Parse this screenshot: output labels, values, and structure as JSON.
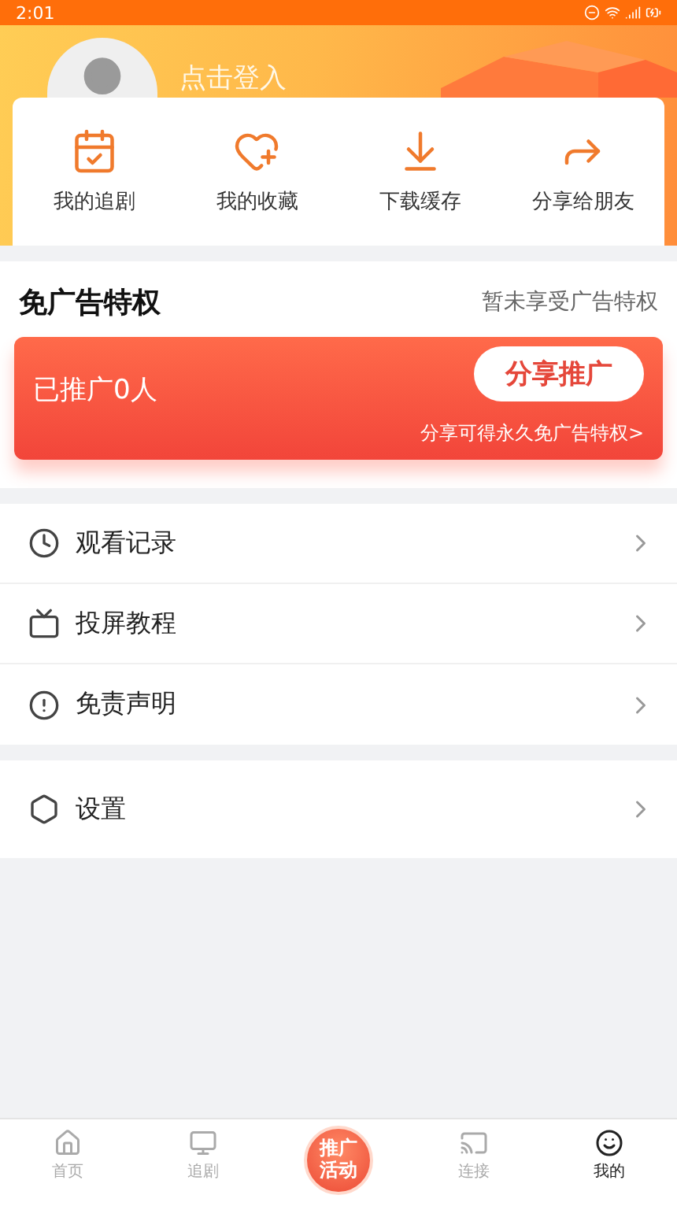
{
  "status_bar": {
    "time": "2:01"
  },
  "profile": {
    "login_label": "点击登入"
  },
  "shortcuts": [
    {
      "label": "我的追剧"
    },
    {
      "label": "我的收藏"
    },
    {
      "label": "下载缓存"
    },
    {
      "label": "分享给朋友"
    }
  ],
  "ad_privilege": {
    "title": "免广告特权",
    "status": "暂未享受广告特权",
    "promoted": "已推广0人",
    "share_button": "分享推广",
    "share_hint": "分享可得永久免广告特权>"
  },
  "menu": [
    {
      "label": "观看记录"
    },
    {
      "label": "投屏教程"
    },
    {
      "label": "免责声明"
    }
  ],
  "settings": [
    {
      "label": "设置"
    }
  ],
  "bottom_nav": [
    {
      "kind": "tab",
      "label": "首页",
      "selected": false
    },
    {
      "kind": "tab",
      "label": "追剧",
      "selected": false
    },
    {
      "kind": "promo",
      "label": "推广活动",
      "selected": false
    },
    {
      "kind": "tab",
      "label": "连接",
      "selected": false
    },
    {
      "kind": "tab",
      "label": "我的",
      "selected": true
    }
  ]
}
